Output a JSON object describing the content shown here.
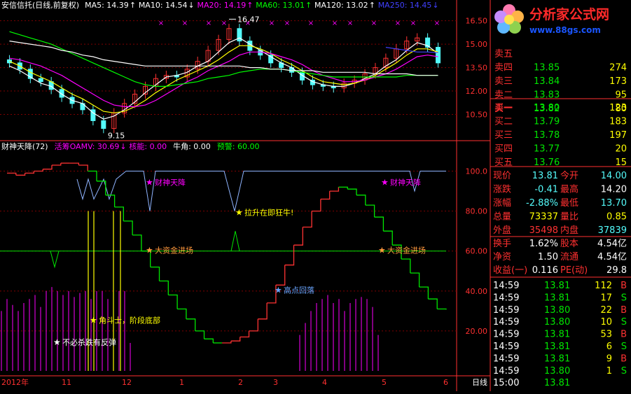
{
  "colors": {
    "bg": "#000000",
    "grid": "#7f0000",
    "axis": "#ff3030",
    "white": "#ffffff",
    "ma5": "#ffffff",
    "ma10": "#ffff00",
    "ma20": "#ff00ff",
    "ma60": "#00ff00",
    "ma120": "#ffffff",
    "ma250": "#4040ff",
    "up": "#ff3232",
    "down": "#54fcfc",
    "green": "#00e600",
    "magenta": "#ff00ff",
    "yellow": "#ffff00",
    "cyan": "#40ffff",
    "blue_label": "#6aa6ff",
    "brand": "#ff2a2a",
    "url": "#1a55ff"
  },
  "top_chart": {
    "legend": [
      {
        "label": "安信信托(日线,前复权)",
        "value": "",
        "color": "#ffffff"
      },
      {
        "label": "MA5: 14.39",
        "arrow": "↑",
        "color": "#ffffff"
      },
      {
        "label": "MA10: 14.54",
        "arrow": "↓",
        "color": "#ffffff"
      },
      {
        "label": "MA20: 14.19",
        "arrow": "↑",
        "color": "#ff00ff"
      },
      {
        "label": "MA60: 13.01",
        "arrow": "↑",
        "color": "#00ff00"
      },
      {
        "label": "MA120: 13.02",
        "arrow": "↑",
        "color": "#ffffff"
      },
      {
        "label": "MA250: 14.45",
        "arrow": "↓",
        "color": "#4040ff"
      }
    ],
    "annotations": {
      "high": "16.47",
      "low": "9.15"
    }
  },
  "bottom_chart": {
    "legend": [
      {
        "label": "财神天降(72)",
        "color": "#ffffff"
      },
      {
        "label": "活筹OAMV: 30.69",
        "arrow": "↓",
        "color": "#ff00ff"
      },
      {
        "label": "核能: 0.00",
        "color": "#ff00ff"
      },
      {
        "label": "牛角: 0.00",
        "color": "#ffffff"
      },
      {
        "label": "预警: 60.00",
        "color": "#00ff00"
      }
    ],
    "labels": {
      "caishen1": "财神天降",
      "caishen2": "财神天降",
      "lashen": "拉升在即狂牛!",
      "daziijn1": "大资金进场",
      "daziijn2": "大资金进场",
      "gaodian": "高点回落",
      "jiaodou": "角斗士，阶段底部",
      "bubi": "不必杀跌有反弹"
    }
  },
  "x_axis": {
    "labels": [
      "2012年",
      "11",
      "12",
      "1",
      "2",
      "3",
      "4",
      "5",
      "6"
    ],
    "period": "日线"
  },
  "chart_data": [
    {
      "type": "line",
      "title": "安信信托(日线,前复权)",
      "ylim": [
        9.0,
        17.2
      ],
      "y_ticks": [
        "16.50",
        "15.00",
        "13.50",
        "12.00",
        "10.50"
      ],
      "series": [
        {
          "name": "MA5",
          "values": [
            13.6,
            13.3,
            12.9,
            12.5,
            12.3,
            11.8,
            11.4,
            11.2,
            10.6,
            10.2,
            10.4,
            10.8,
            11.3,
            11.9,
            12.4,
            12.9,
            13.0,
            13.2,
            13.6,
            13.9,
            14.5,
            15.1,
            15.4,
            15.0,
            14.6,
            14.2,
            13.8,
            13.5,
            13.0,
            12.6,
            12.4,
            12.3,
            12.3,
            12.5,
            12.8,
            13.1,
            13.6,
            14.0,
            14.6,
            15.1,
            14.9,
            14.4
          ]
        },
        {
          "name": "MA10",
          "values": [
            13.9,
            13.6,
            13.2,
            12.9,
            12.6,
            12.2,
            11.8,
            11.5,
            11.1,
            10.7,
            10.6,
            10.7,
            11.0,
            11.4,
            11.9,
            12.3,
            12.7,
            13.0,
            13.3,
            13.6,
            14.0,
            14.5,
            14.9,
            14.9,
            14.7,
            14.4,
            14.0,
            13.7,
            13.3,
            12.9,
            12.6,
            12.5,
            12.4,
            12.5,
            12.7,
            13.0,
            13.4,
            13.8,
            14.3,
            14.7,
            14.7,
            14.5
          ]
        },
        {
          "name": "MA20",
          "values": [
            14.1,
            14.0,
            13.8,
            13.6,
            13.3,
            13.0,
            12.6,
            12.2,
            11.8,
            11.4,
            11.1,
            11.0,
            11.0,
            11.1,
            11.4,
            11.8,
            12.2,
            12.6,
            12.9,
            13.3,
            13.6,
            13.9,
            14.3,
            14.5,
            14.5,
            14.4,
            14.2,
            14.0,
            13.7,
            13.3,
            13.0,
            12.8,
            12.6,
            12.6,
            12.7,
            12.9,
            13.1,
            13.4,
            13.8,
            14.2,
            14.3,
            14.2
          ]
        },
        {
          "name": "MA60",
          "values": [
            15.8,
            15.6,
            15.4,
            15.2,
            15.0,
            14.7,
            14.4,
            14.1,
            13.8,
            13.5,
            13.2,
            12.9,
            12.6,
            12.4,
            12.3,
            12.3,
            12.4,
            12.5,
            12.6,
            12.8,
            12.9,
            13.0,
            13.2,
            13.3,
            13.4,
            13.4,
            13.4,
            13.3,
            13.2,
            13.1,
            13.0,
            12.9,
            12.9,
            12.9,
            12.9,
            12.9,
            12.9,
            12.9,
            13.0,
            13.0,
            13.0,
            13.0
          ]
        },
        {
          "name": "MA120",
          "values": [
            15.2,
            15.1,
            15.0,
            14.9,
            14.8,
            14.6,
            14.5,
            14.3,
            14.2,
            14.0,
            13.9,
            13.8,
            13.7,
            13.6,
            13.6,
            13.6,
            13.6,
            13.6,
            13.6,
            13.6,
            13.6,
            13.6,
            13.6,
            13.5,
            13.5,
            13.4,
            13.4,
            13.3,
            13.3,
            13.3,
            13.2,
            13.2,
            13.2,
            13.2,
            13.2,
            13.1,
            13.1,
            13.1,
            13.1,
            13.0,
            13.0,
            13.0
          ]
        },
        {
          "name": "MA250",
          "values": [
            null,
            null,
            null,
            null,
            null,
            null,
            null,
            null,
            null,
            null,
            null,
            null,
            null,
            null,
            null,
            null,
            null,
            null,
            null,
            null,
            null,
            null,
            null,
            null,
            null,
            null,
            null,
            null,
            null,
            null,
            null,
            null,
            null,
            null,
            null,
            null,
            14.8,
            14.7,
            14.6,
            14.5,
            14.5,
            14.45
          ]
        }
      ],
      "candles_close": [
        13.8,
        13.4,
        12.8,
        12.6,
        12.1,
        11.6,
        11.2,
        10.8,
        10.1,
        9.6,
        10.6,
        11.2,
        11.8,
        12.3,
        12.8,
        13.0,
        12.9,
        13.4,
        13.9,
        14.6,
        15.3,
        16.0,
        15.2,
        14.6,
        14.3,
        13.8,
        13.5,
        13.2,
        12.7,
        12.4,
        12.3,
        12.2,
        12.5,
        12.7,
        13.1,
        13.5,
        14.1,
        14.7,
        15.2,
        15.4,
        14.8,
        13.8
      ]
    },
    {
      "type": "line",
      "title": "财神天降(72)",
      "ylim": [
        0,
        110
      ],
      "y_ticks": [
        "100.0",
        "80.00",
        "60.00",
        "40.00",
        "20.00"
      ],
      "series": [
        {
          "name": "活筹OAMV",
          "values": [
            99,
            98,
            99,
            100,
            101,
            103,
            104,
            104,
            103,
            100,
            95,
            88,
            82,
            75,
            68,
            60,
            52,
            45,
            38,
            31,
            26,
            20,
            16,
            14,
            14,
            15,
            17,
            20,
            26,
            34,
            43,
            53,
            63,
            72,
            80,
            86,
            90,
            92,
            91,
            88,
            83,
            77,
            70,
            63,
            56,
            49,
            42,
            36,
            31,
            30.69
          ]
        },
        {
          "name": "预警",
          "values": [
            60,
            60,
            60,
            60,
            60,
            60,
            60,
            60,
            60,
            60,
            60,
            60,
            60,
            60,
            60,
            60,
            60,
            60,
            60,
            60,
            60,
            60,
            60,
            60,
            60,
            60,
            60,
            60,
            60,
            60,
            60,
            60,
            60,
            60,
            60,
            60,
            60,
            60,
            60,
            60,
            60,
            60,
            60,
            60,
            60,
            60,
            60,
            60,
            60,
            60
          ]
        },
        {
          "name": "核能",
          "values": [
            0,
            0,
            0,
            0,
            0,
            0,
            0,
            0,
            0,
            0,
            0,
            0,
            0,
            0,
            0,
            0,
            0,
            0,
            0,
            0,
            0,
            0,
            0,
            0,
            0,
            0,
            0,
            0,
            0,
            0,
            0,
            0,
            0,
            0,
            0,
            0,
            0,
            0,
            0,
            0,
            0,
            0,
            0,
            0,
            0,
            0,
            0,
            0,
            0,
            0
          ]
        },
        {
          "name": "牛角",
          "values": [
            0,
            0,
            0,
            0,
            0,
            0,
            0,
            0,
            0,
            0,
            0,
            0,
            0,
            0,
            0,
            0,
            0,
            0,
            0,
            0,
            0,
            0,
            0,
            0,
            0,
            0,
            0,
            0,
            0,
            0,
            0,
            0,
            0,
            0,
            0,
            0,
            0,
            0,
            0,
            0,
            0,
            0,
            0,
            0,
            0,
            0,
            0,
            0,
            0,
            0
          ]
        }
      ]
    }
  ],
  "quote": {
    "asks": [
      {
        "label": "卖五",
        "price": "",
        "vol": ""
      },
      {
        "label": "卖四",
        "price": "13.85",
        "vol": "274"
      },
      {
        "label": "卖三",
        "price": "13.84",
        "vol": "173"
      },
      {
        "label": "卖二",
        "price": "13.83",
        "vol": "95"
      },
      {
        "label": "卖一",
        "price": "13.82",
        "vol": "80"
      }
    ],
    "bids": [
      {
        "label": "买一",
        "price": "13.80",
        "vol": "123"
      },
      {
        "label": "买二",
        "price": "13.79",
        "vol": "183"
      },
      {
        "label": "买三",
        "price": "13.78",
        "vol": "197"
      },
      {
        "label": "买四",
        "price": "13.77",
        "vol": "20"
      },
      {
        "label": "买五",
        "price": "13.76",
        "vol": "15"
      }
    ],
    "stats": [
      {
        "l1": "现价",
        "v1": "13.81",
        "l2": "今开",
        "v2": "14.00",
        "c1": "#54fcfc",
        "c2": "#54fcfc"
      },
      {
        "l1": "涨跌",
        "v1": "-0.41",
        "l2": "最高",
        "v2": "14.20",
        "c1": "#54fcfc",
        "c2": "#ffffff"
      },
      {
        "l1": "涨幅",
        "v1": "-2.88%",
        "l2": "最低",
        "v2": "13.70",
        "c1": "#54fcfc",
        "c2": "#54fcfc"
      },
      {
        "l1": "总量",
        "v1": "73337",
        "l2": "量比",
        "v2": "0.85",
        "c1": "#ffff00",
        "c2": "#ffff00"
      },
      {
        "l1": "外盘",
        "v1": "35498",
        "l2": "内盘",
        "v2": "37839",
        "c1": "#ff3232",
        "c2": "#54fcfc"
      }
    ],
    "stats2": [
      {
        "l1": "换手",
        "v1": "1.62%",
        "l2": "股本",
        "v2": "4.54亿"
      },
      {
        "l1": "净资",
        "v1": "1.50",
        "l2": "流通",
        "v2": "4.54亿"
      },
      {
        "l1": "收益(一)",
        "v1": "0.116",
        "l2": "PE(动)",
        "v2": "29.8"
      }
    ],
    "ticks": [
      {
        "time": "14:59",
        "price": "13.81",
        "vol": "112",
        "side": "B"
      },
      {
        "time": "14:59",
        "price": "13.81",
        "vol": "17",
        "side": "S"
      },
      {
        "time": "14:59",
        "price": "13.80",
        "vol": "22",
        "side": "B"
      },
      {
        "time": "14:59",
        "price": "13.80",
        "vol": "10",
        "side": "S"
      },
      {
        "time": "14:59",
        "price": "13.81",
        "vol": "53",
        "side": "B"
      },
      {
        "time": "14:59",
        "price": "13.81",
        "vol": "6",
        "side": "S"
      },
      {
        "time": "14:59",
        "price": "13.81",
        "vol": "9",
        "side": "B"
      },
      {
        "time": "14:59",
        "price": "13.80",
        "vol": "1",
        "side": "S"
      },
      {
        "time": "15:00",
        "price": "13.81",
        "vol": "",
        "side": ""
      }
    ]
  },
  "watermark": {
    "title": "分析家公式网",
    "url": "www.88gs.com"
  }
}
